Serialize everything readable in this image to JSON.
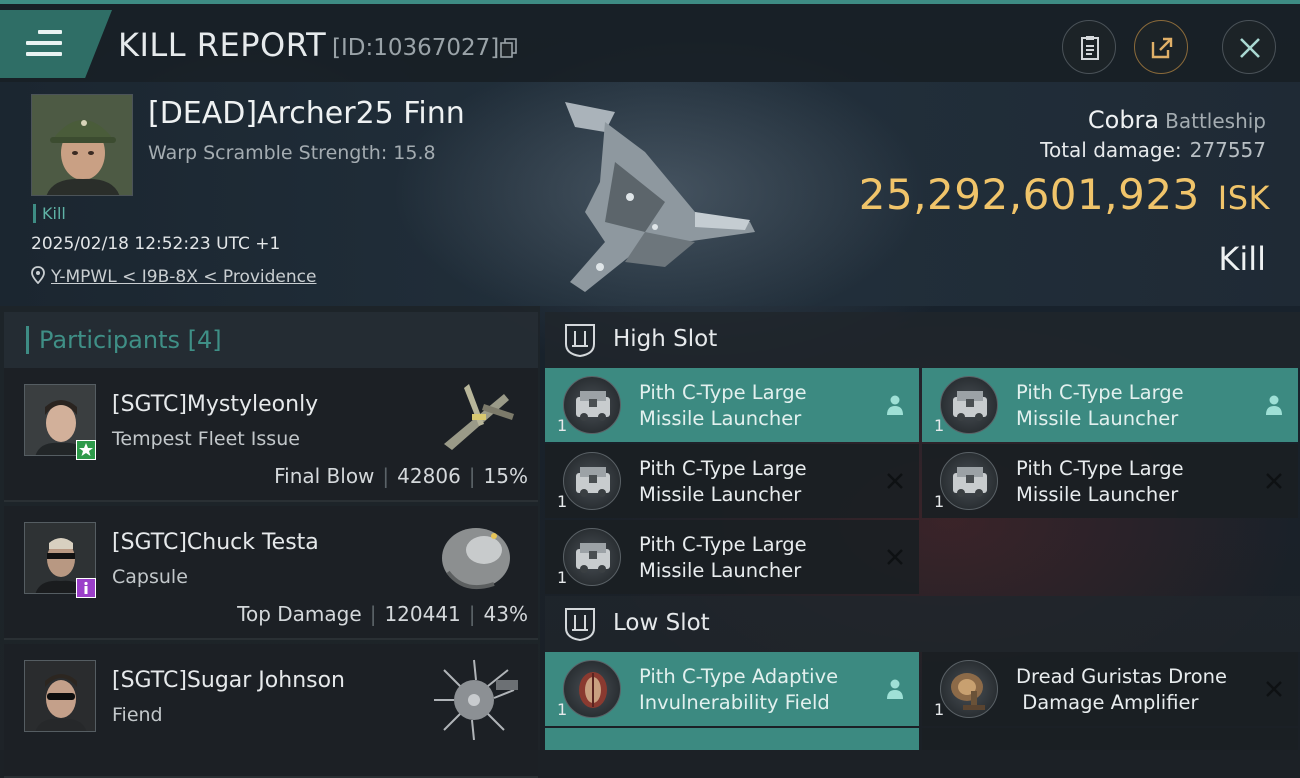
{
  "header": {
    "title": "KILL REPORT",
    "report_id": "[ID:10367027]"
  },
  "victim": {
    "name": "[DEAD]Archer25 Finn",
    "subtitle": "Warp Scramble Strength: 15.8",
    "tag": "Kill",
    "datetime": "2025/02/18 12:52:23 UTC +1",
    "location": "Y-MPWL < I9B-8X < Providence",
    "ship_name": "Cobra",
    "ship_class": "Battleship",
    "total_damage_label": "Total damage:",
    "total_damage_value": "277557",
    "isk_value": "25,292,601,923",
    "isk_unit": "ISK",
    "result": "Kill"
  },
  "participants": {
    "label": "Participants [4]",
    "rows": [
      {
        "name": "[SGTC]Mystyleonly",
        "ship": "Tempest Fleet Issue",
        "stat_label": "Final Blow",
        "damage": "42806",
        "percent": "15%",
        "badge_color": "#2e9a4a"
      },
      {
        "name": "[SGTC]Chuck Testa",
        "ship": "Capsule",
        "stat_label": "Top Damage",
        "damage": "120441",
        "percent": "43%",
        "badge_color": "#9b3fc9"
      },
      {
        "name": "[SGTC]Sugar Johnson",
        "ship": "Fiend",
        "stat_label": "",
        "damage": "",
        "percent": ""
      }
    ]
  },
  "high_slot": {
    "label": "High Slot",
    "modules": [
      {
        "line1": "Pith C-Type Large",
        "line2": "Missile Launcher",
        "qty": "1",
        "state": "dropped"
      },
      {
        "line1": "Pith C-Type Large",
        "line2": "Missile Launcher",
        "qty": "1",
        "state": "dropped"
      },
      {
        "line1": "Pith C-Type Large",
        "line2": "Missile Launcher",
        "qty": "1",
        "state": "destroyed"
      },
      {
        "line1": "Pith C-Type Large",
        "line2": "Missile Launcher",
        "qty": "1",
        "state": "destroyed"
      },
      {
        "line1": "Pith C-Type Large",
        "line2": "Missile Launcher",
        "qty": "1",
        "state": "destroyed"
      }
    ]
  },
  "low_slot": {
    "label": "Low Slot",
    "modules": [
      {
        "line1": "Pith C-Type Adaptive",
        "line2": "Invulnerability Field",
        "qty": "1",
        "state": "dropped"
      },
      {
        "line1": "Dread Guristas Drone",
        "line2": " Damage Amplifier",
        "qty": "1",
        "state": "destroyed"
      }
    ]
  },
  "icons": {
    "menu": "menu-icon",
    "copy": "copy-icon",
    "clipboard": "clipboard-icon",
    "share": "share-icon",
    "close": "close-icon",
    "location": "location-pin-icon",
    "slot": "slot-shield-icon",
    "dropped": "person-icon",
    "destroyed": "cross-icon"
  },
  "colors": {
    "accent": "#3e8c84",
    "isk": "#f0c46a",
    "active_module": "#3c8a81"
  }
}
